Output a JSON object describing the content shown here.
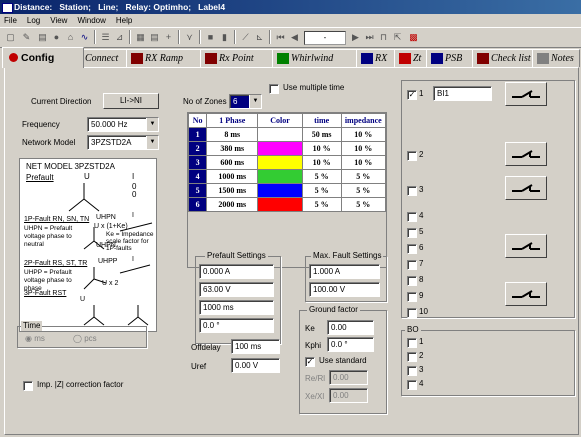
{
  "title": {
    "text": "Distance:   Station;   Line;   Relay: Optimho;   Label4"
  },
  "menu": [
    {
      "label": "File"
    },
    {
      "label": "Log"
    },
    {
      "label": "View"
    },
    {
      "label": "Window"
    },
    {
      "label": "Help"
    }
  ],
  "toolbar": {
    "step_value": "-"
  },
  "tabs": [
    {
      "label": "Config",
      "icon": "config-icon",
      "color": "#c00000",
      "active": true
    },
    {
      "label": "Connect",
      "icon": "connect-icon",
      "color": "#404040"
    },
    {
      "label": "RX Ramp",
      "icon": "rx-ramp-icon",
      "color": "#800000"
    },
    {
      "label": "Rx Point",
      "icon": "rx-point-icon",
      "color": "#800000"
    },
    {
      "label": "Whirlwind",
      "icon": "whirlwind-icon",
      "color": "#008000"
    },
    {
      "label": "RX",
      "icon": "rx-icon",
      "color": "#000080"
    },
    {
      "label": "Zt",
      "icon": "zt-icon",
      "color": "#c00000"
    },
    {
      "label": "PSB",
      "icon": "psb-icon",
      "color": "#000080"
    },
    {
      "label": "Check list",
      "icon": "checklist-icon",
      "color": "#800000"
    },
    {
      "label": "Notes",
      "icon": "notes-icon",
      "color": "#404040"
    }
  ],
  "config": {
    "current_direction_label": "Current Direction",
    "current_direction_value": "LI->NI",
    "frequency_label": "Frequency",
    "frequency_value": "50.000 Hz",
    "network_model_label": "Network Model",
    "network_model_value": "3PZSTD2A",
    "zones_label": "No of Zones",
    "zones_value": "6",
    "use_multiple_time": "Use multiple time",
    "use_multiple_time_checked": false,
    "zone_table": {
      "headers": [
        "No",
        "1 Phase",
        "Color",
        "time",
        "impedance"
      ],
      "rows": [
        {
          "no": "1",
          "phase": "8   ms",
          "color": "#ffffff",
          "time": "50  ms",
          "impedance": "10 %"
        },
        {
          "no": "2",
          "phase": "380  ms",
          "color": "#ff00ff",
          "time": "10  %",
          "impedance": "10 %"
        },
        {
          "no": "3",
          "phase": "600  ms",
          "color": "#ffff00",
          "time": "10  %",
          "impedance": "10 %"
        },
        {
          "no": "4",
          "phase": "1000  ms",
          "color": "#33cc33",
          "time": "5  %",
          "impedance": "5  %"
        },
        {
          "no": "5",
          "phase": "1500  ms",
          "color": "#0000ff",
          "time": "5  %",
          "impedance": "5  %"
        },
        {
          "no": "6",
          "phase": "2000  ms",
          "color": "#ff0000",
          "time": "5  %",
          "impedance": "5  %"
        }
      ]
    },
    "diagram": {
      "title": "NET MODEL 3PZSTD2A",
      "prefault": "Prefault",
      "u": "U",
      "i": "I",
      "zero1": "0",
      "zero2": "0",
      "fault1_title": "1P-Fault RN, SN, TN",
      "uhpn": "UHPN",
      "ux_formula": "U x (1+Ke)",
      "uhpn_desc": "UHPN = Prefault voltage phase to neutral",
      "ke_desc": "Ke = Impedance scale factor for 1P-faults",
      "uhpn2": "UHPN",
      "fault2_title": "2P-Fault RS, ST, TR",
      "uhpp": "UHPP",
      "uhpp_desc": "UHPP = Prefault voltage phase to phase",
      "ux2": "U x 2",
      "fault3_title": "3P-Fault RST",
      "u3": "U",
      "i2": "I",
      "i3": "I"
    },
    "time_group": {
      "label": "Time",
      "ms": "ms",
      "pcs": "pcs"
    },
    "imp_correction": "Imp. |Z| correction factor",
    "prefault_settings": {
      "label": "Prefault Settings",
      "current": "0.000 A",
      "voltage": "63.00 V",
      "time": "1000 ms",
      "angle": "0.0 °"
    },
    "max_fault_settings": {
      "label": "Max. Fault Settings",
      "current": "1.000 A",
      "voltage": "100.00 V"
    },
    "ground_factor": {
      "label": "Ground factor",
      "ke_label": "Ke",
      "ke_value": "0.00",
      "kphi_label": "Kphi",
      "kphi_value": "0.0 °",
      "use_standard": "Use standard",
      "use_standard_checked": true,
      "rerl_label": "Re/Rl",
      "rerl_value": "0.00",
      "xexl_label": "Xe/Xl",
      "xexl_value": "0.00"
    },
    "offdelay_label": "Offdelay",
    "offdelay_value": "100 ms",
    "uref_label": "Uref",
    "uref_value": "0.00 V"
  },
  "binary_inputs": {
    "items": [
      {
        "num": "1",
        "checked": true,
        "name": "BI1"
      },
      {
        "num": "2",
        "checked": false
      },
      {
        "num": "3",
        "checked": false
      },
      {
        "num": "4",
        "checked": false
      },
      {
        "num": "5",
        "checked": false
      },
      {
        "num": "6",
        "checked": false
      },
      {
        "num": "7",
        "checked": false
      },
      {
        "num": "8",
        "checked": false
      },
      {
        "num": "9",
        "checked": false
      },
      {
        "num": "10",
        "checked": false
      }
    ],
    "bo_label": "BO",
    "bo_items": [
      {
        "num": "1"
      },
      {
        "num": "2"
      },
      {
        "num": "3"
      },
      {
        "num": "4"
      }
    ]
  }
}
